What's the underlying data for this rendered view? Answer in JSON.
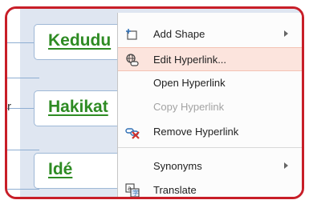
{
  "canvas": {
    "shapes": [
      {
        "text": "Kedudu"
      },
      {
        "text": "Hakikat"
      },
      {
        "text": "Idé"
      }
    ],
    "stray_char": "r"
  },
  "context_menu": {
    "items": [
      {
        "label": "Add Shape",
        "icon": "add-shape-icon",
        "submenu": true,
        "enabled": true
      },
      {
        "label": "Edit Hyperlink...",
        "icon": "edit-hyperlink-icon",
        "submenu": false,
        "enabled": true,
        "highlighted": true
      },
      {
        "label": "Open Hyperlink",
        "icon": "",
        "submenu": false,
        "enabled": true
      },
      {
        "label": "Copy Hyperlink",
        "icon": "",
        "submenu": false,
        "enabled": false
      },
      {
        "label": "Remove Hyperlink",
        "icon": "remove-hyperlink-icon",
        "submenu": false,
        "enabled": true
      },
      {
        "label": "Synonyms",
        "icon": "",
        "submenu": true,
        "enabled": true
      },
      {
        "label": "Translate",
        "icon": "translate-icon",
        "submenu": false,
        "enabled": true
      }
    ]
  },
  "colors": {
    "frame_border": "#c81e28",
    "shape_text": "#2e8b23",
    "highlight_bg": "#fce4dd"
  }
}
